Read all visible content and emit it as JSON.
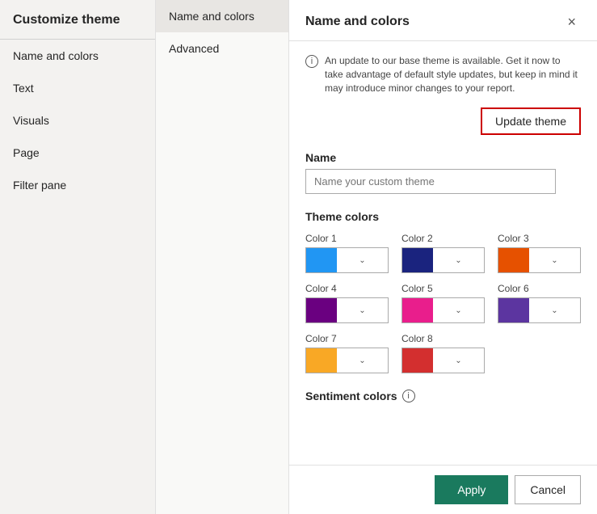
{
  "sidebar": {
    "title": "Customize theme",
    "nav_items": [
      {
        "id": "name-and-colors",
        "label": "Name and colors"
      },
      {
        "id": "text",
        "label": "Text"
      },
      {
        "id": "visuals",
        "label": "Visuals"
      },
      {
        "id": "page",
        "label": "Page"
      },
      {
        "id": "filter-pane",
        "label": "Filter pane"
      }
    ]
  },
  "tabs": [
    {
      "id": "name-and-colors",
      "label": "Name and colors",
      "active": true
    },
    {
      "id": "advanced",
      "label": "Advanced"
    }
  ],
  "main": {
    "title": "Name and colors",
    "close_btn": "×",
    "info_text": "An update to our base theme is available. Get it now to take advantage of default style updates, but keep in mind it may introduce minor changes to your report.",
    "info_icon": "i",
    "update_theme_label": "Update theme",
    "name_field_label": "Name",
    "name_placeholder": "Name your custom theme",
    "theme_colors_title": "Theme colors",
    "colors": [
      {
        "id": "color1",
        "label": "Color 1",
        "color": "#2196f3"
      },
      {
        "id": "color2",
        "label": "Color 2",
        "color": "#1a237e"
      },
      {
        "id": "color3",
        "label": "Color 3",
        "color": "#e65100"
      },
      {
        "id": "color4",
        "label": "Color 4",
        "color": "#6a0080"
      },
      {
        "id": "color5",
        "label": "Color 5",
        "color": "#e91e8c"
      },
      {
        "id": "color6",
        "label": "Color 6",
        "color": "#5c35a0"
      },
      {
        "id": "color7",
        "label": "Color 7",
        "color": "#f9a825"
      },
      {
        "id": "color8",
        "label": "Color 8",
        "color": "#d32f2f"
      }
    ],
    "sentiment_label": "Sentiment colors",
    "sentiment_info": "i"
  },
  "footer": {
    "apply_label": "Apply",
    "cancel_label": "Cancel"
  }
}
